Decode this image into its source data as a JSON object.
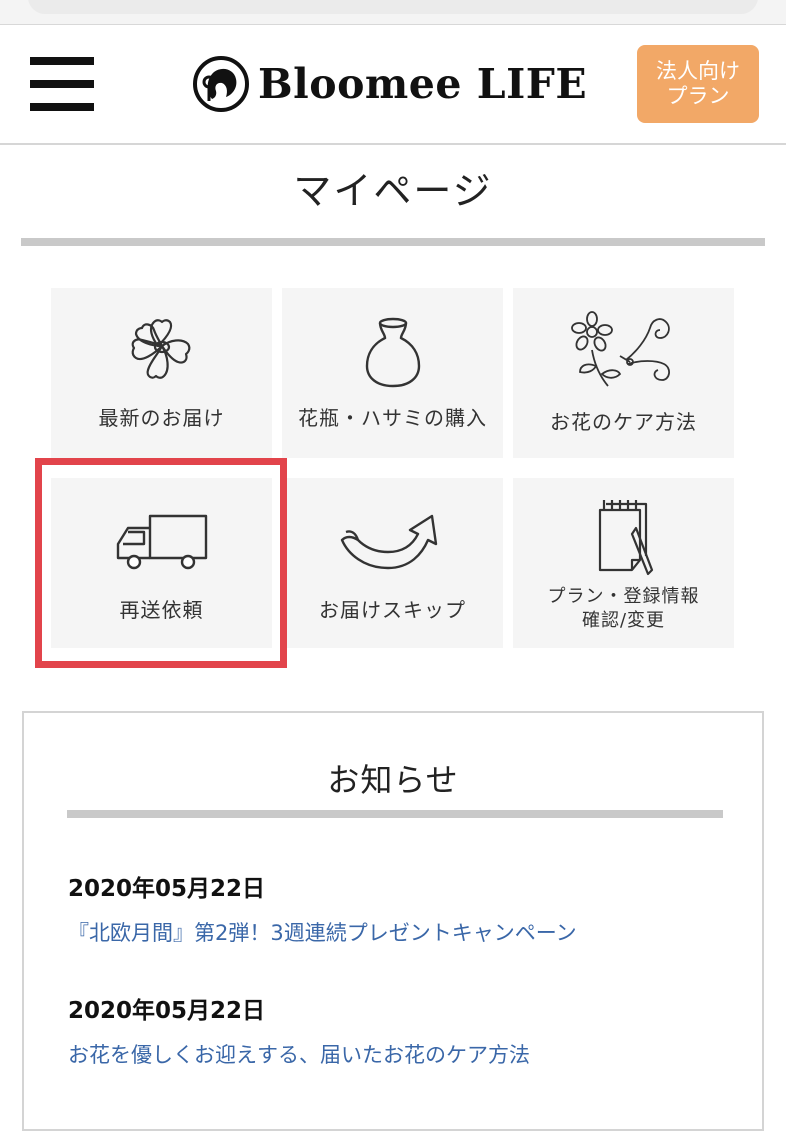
{
  "header": {
    "logo_text": "Bloomee LIFE",
    "corp_button_line1": "法人向け",
    "corp_button_line2": "プラン"
  },
  "page": {
    "title": "マイページ"
  },
  "tiles": [
    {
      "label": "最新のお届け",
      "icon": "flower-icon"
    },
    {
      "label": "花瓶・ハサミの購入",
      "icon": "vase-icon"
    },
    {
      "label": "お花のケア方法",
      "icon": "flower-scissors-icon"
    },
    {
      "label": "再送依頼",
      "icon": "delivery-truck-icon"
    },
    {
      "label": "お届けスキップ",
      "icon": "skip-arrow-icon"
    },
    {
      "label_line1": "プラン・登録情報",
      "label_line2": "確認/変更",
      "icon": "notepad-pencil-icon"
    }
  ],
  "news": {
    "title": "お知らせ",
    "items": [
      {
        "date": "2020年05月22日",
        "text": "『北欧月間』第2弾！3週連続プレゼントキャンペーン"
      },
      {
        "date": "2020年05月22日",
        "text": "お花を優しくお迎えする、届いたお花のケア方法"
      }
    ]
  },
  "colors": {
    "accent_orange": "#f2a867",
    "highlight_red": "#e2444b",
    "link_blue": "#3a67a8",
    "tile_bg": "#f5f5f5"
  }
}
